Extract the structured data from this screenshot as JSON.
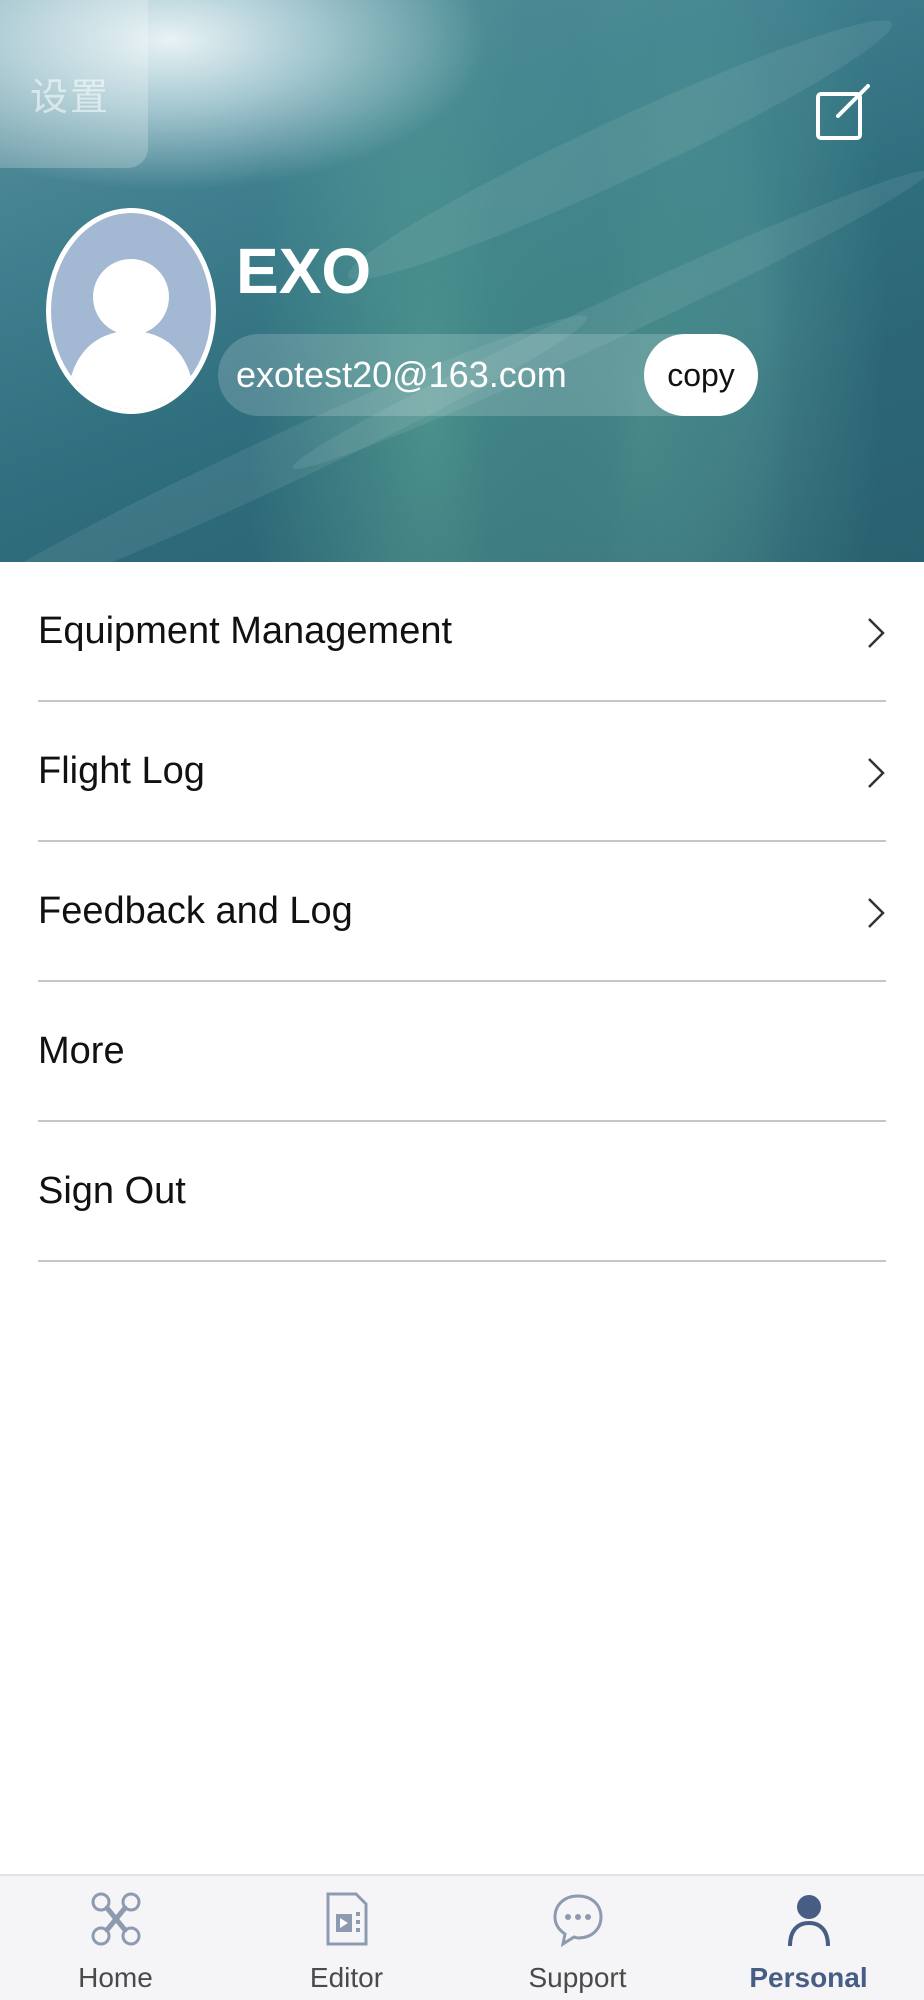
{
  "header": {
    "settings_label": "设置",
    "user_name": "EXO",
    "email": "exotest20@163.com",
    "copy_label": "copy"
  },
  "menu": {
    "items": [
      {
        "label": "Equipment Management",
        "has_chevron": true
      },
      {
        "label": "Flight Log",
        "has_chevron": true
      },
      {
        "label": "Feedback and Log",
        "has_chevron": true
      },
      {
        "label": "More",
        "has_chevron": false
      },
      {
        "label": "Sign Out",
        "has_chevron": false
      }
    ]
  },
  "tabbar": {
    "tabs": [
      {
        "label": "Home",
        "icon": "home-drone-icon",
        "active": false
      },
      {
        "label": "Editor",
        "icon": "editor-film-icon",
        "active": false
      },
      {
        "label": "Support",
        "icon": "chat-bubble-icon",
        "active": false
      },
      {
        "label": "Personal",
        "icon": "person-icon",
        "active": true
      }
    ]
  },
  "colors": {
    "active_tab": "#475d84",
    "inactive_tab": "#4a4a4a",
    "divider": "#c6c6c6",
    "avatar_bg": "#a3b8d3"
  }
}
